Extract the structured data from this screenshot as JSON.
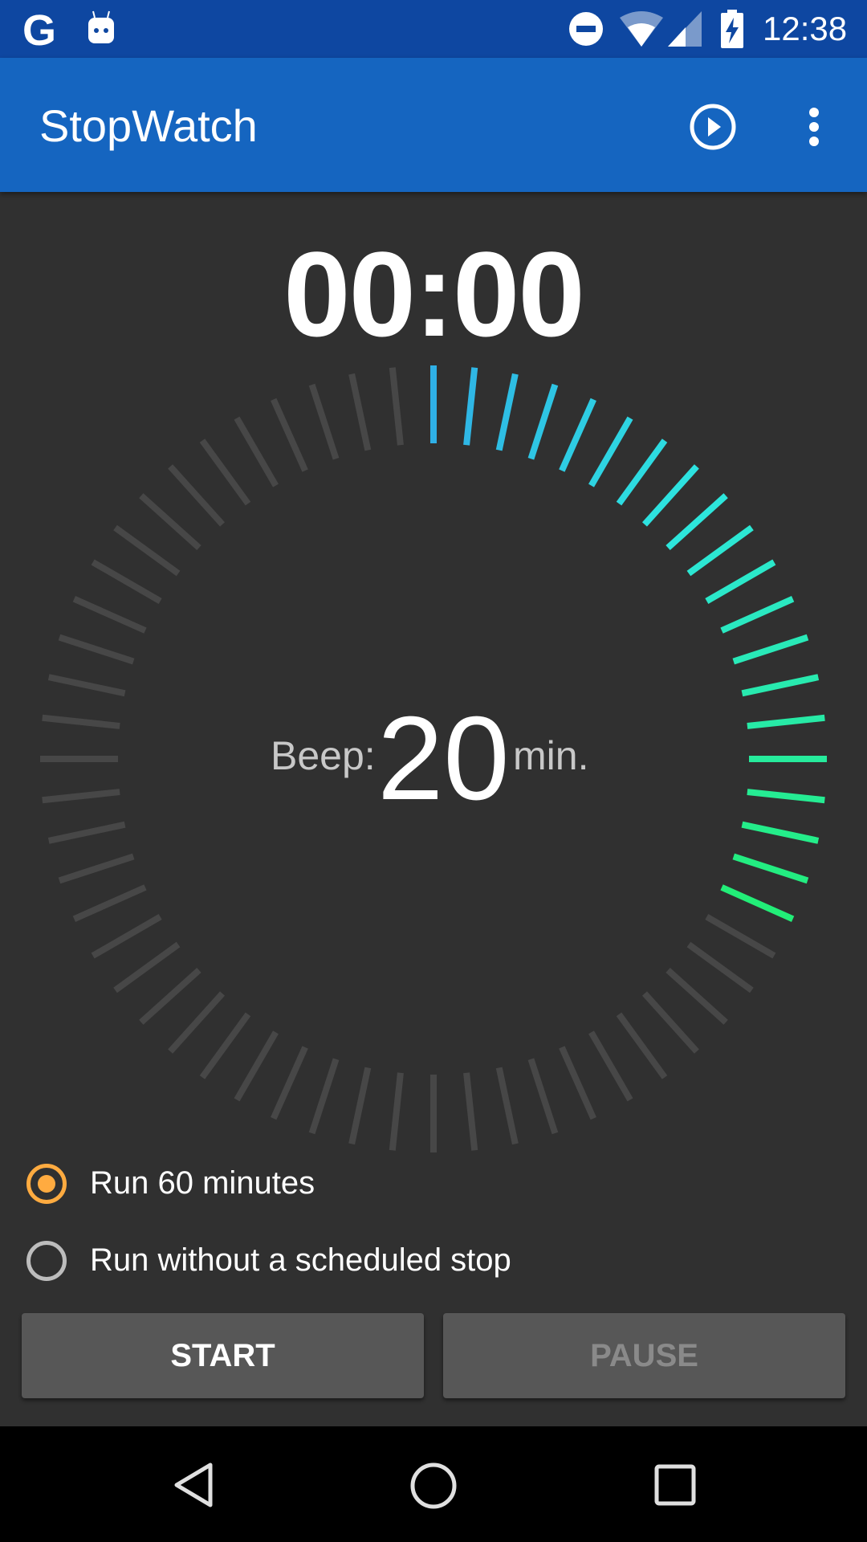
{
  "status_bar": {
    "time": "12:38",
    "icons": [
      "google-icon",
      "android-icon",
      "do-not-disturb-icon",
      "wifi-icon",
      "signal-icon",
      "battery-charging-icon"
    ]
  },
  "app_bar": {
    "title": "StopWatch",
    "actions": [
      "play-circle-icon",
      "more-vert-icon"
    ]
  },
  "timer": {
    "display": "00:00"
  },
  "dial": {
    "total_ticks": 60,
    "active_ticks": 20,
    "active_color_start": "#2fb0e6",
    "active_color_mid": "#2de6e0",
    "active_color_end": "#22ee78",
    "inactive_color": "#474747"
  },
  "beep": {
    "label": "Beep:",
    "value": "20",
    "unit": "min."
  },
  "options": [
    {
      "label": "Run 60 minutes",
      "selected": true
    },
    {
      "label": "Run without a scheduled stop",
      "selected": false
    }
  ],
  "buttons": {
    "start": "START",
    "pause": "PAUSE"
  },
  "colors": {
    "status_bar": "#0e47a1",
    "app_bar": "#1565c0",
    "background": "#303030",
    "accent": "#ffab40",
    "button": "#575757",
    "disabled_text": "#8a8a8a"
  },
  "nav_bar": {
    "icons": [
      "back-icon",
      "home-icon",
      "recents-icon"
    ]
  }
}
